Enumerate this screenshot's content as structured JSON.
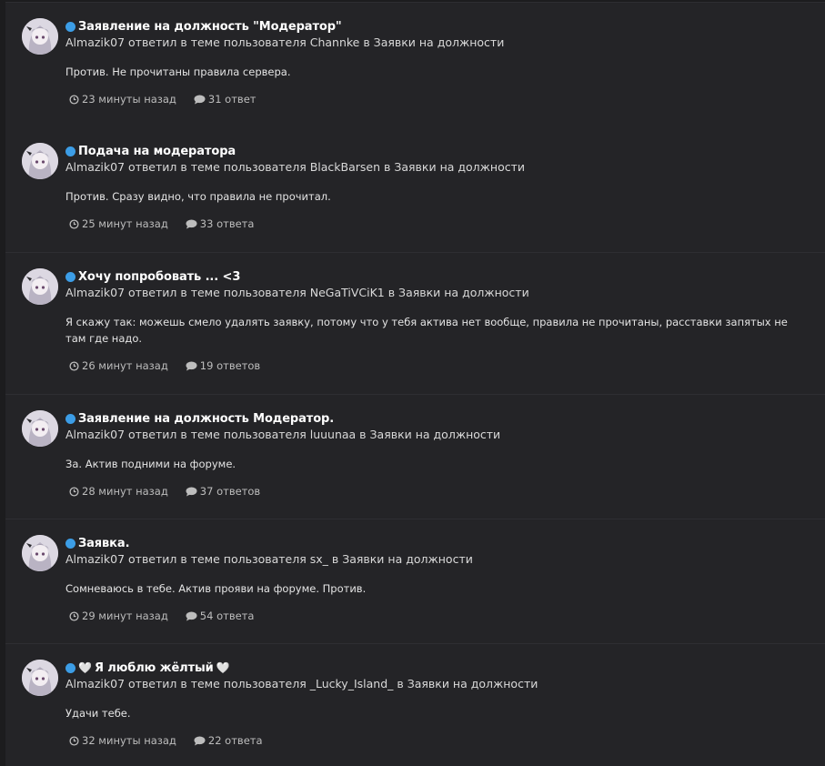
{
  "items": [
    {
      "title": "Заявление на должность \"Модератор\"",
      "meta": "Almazik07 ответил в теме пользователя Channke в Заявки на должности",
      "snippet": "Против. Не прочитаны правила сервера.",
      "time": "23 минуты назад",
      "replies": "31 ответ"
    },
    {
      "title": "Подача на модератора",
      "meta": "Almazik07 ответил в теме пользователя BlackBarsen в Заявки на должности",
      "snippet": "Против. Сразу видно, что правила не прочитал.",
      "time": "25 минут назад",
      "replies": "33 ответа"
    },
    {
      "title": "Хочу попробовать ... <3",
      "meta": "Almazik07 ответил в теме пользователя NeGaTiVCiK1 в Заявки на должности",
      "snippet": "Я скажу так: можешь смело удалять заявку, потому что у тебя актива нет вообще, правила не прочитаны, расставки запятых не там где надо.",
      "time": "26 минут назад",
      "replies": "19 ответов"
    },
    {
      "title": "Заявление на должность Модератор.",
      "meta": "Almazik07 ответил в теме пользователя luuunaa в Заявки на должности",
      "snippet": "За. Актив подними на форуме.",
      "time": "28 минут назад",
      "replies": "37 ответов"
    },
    {
      "title": "Заявка.",
      "meta": "Almazik07 ответил в теме пользователя sx_ в Заявки на должности",
      "snippet": "Сомневаюсь в тебе. Актив прояви на форуме. Против.",
      "time": "29 минут назад",
      "replies": "54 ответа"
    },
    {
      "title": "Я люблю жёлтый",
      "meta": "Almazik07 ответил в теме пользователя _Lucky_Island_ в Заявки на должности",
      "snippet": "Удачи тебе.",
      "time": "32 минуты назад",
      "replies": "22 ответа"
    }
  ],
  "heart_glyph": "🤍",
  "colors": {
    "unread": "#3c9de6",
    "background": "#1c1c1e",
    "card": "#242427"
  }
}
